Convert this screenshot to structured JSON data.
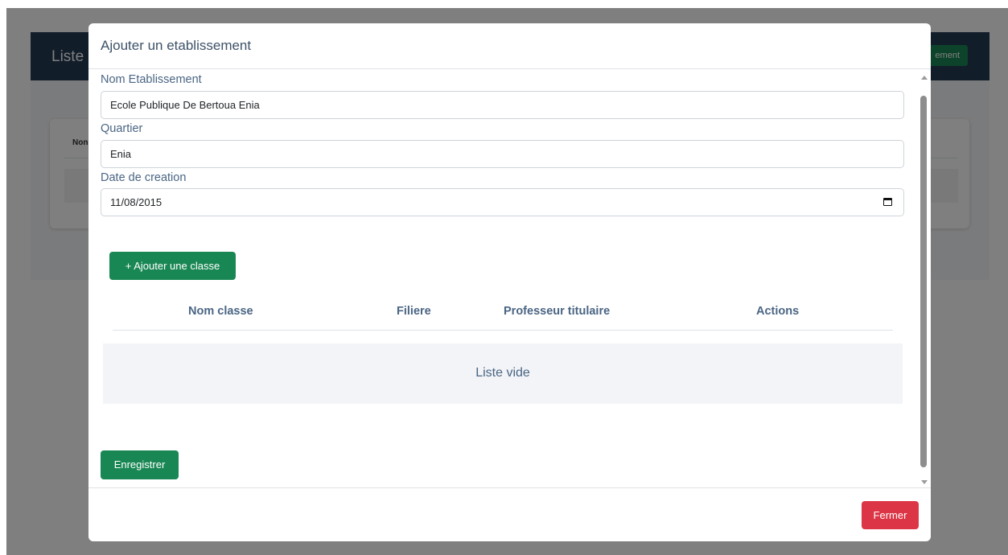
{
  "background": {
    "header_title": "Liste",
    "header_button_label": "ement",
    "card_column": "Non"
  },
  "modal": {
    "title": "Ajouter un etablissement",
    "fields": {
      "nom": {
        "label": "Nom Etablissement",
        "value": "Ecole Publique De Bertoua Enia"
      },
      "quartier": {
        "label": "Quartier",
        "value": "Enia"
      },
      "date": {
        "label": "Date de creation",
        "value": "11/08/2015"
      }
    },
    "add_class_button": "+ Ajouter une classe",
    "table": {
      "columns": [
        "Nom classe",
        "Filiere",
        "Professeur titulaire",
        "Actions"
      ],
      "empty_text": "Liste vide"
    },
    "save_button": "Enregistrer",
    "close_button": "Fermer"
  },
  "colors": {
    "header": "#243b55",
    "green": "#198754",
    "red": "#dc3545",
    "label": "#4a6584"
  },
  "icons": [
    "calendar-icon",
    "scroll-up-icon",
    "scroll-down-icon"
  ]
}
